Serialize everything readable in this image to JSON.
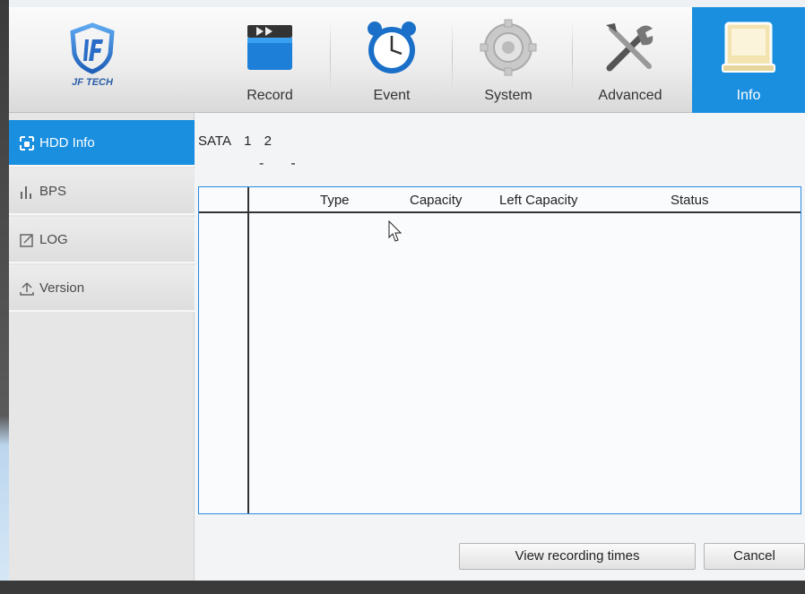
{
  "logo": {
    "text": "JF TECH"
  },
  "nav": [
    {
      "label": "Record",
      "icon": "record-clapper-icon"
    },
    {
      "label": "Event",
      "icon": "alarm-clock-icon"
    },
    {
      "label": "System",
      "icon": "gear-icon"
    },
    {
      "label": "Advanced",
      "icon": "tools-icon"
    },
    {
      "label": "Info",
      "icon": "info-document-icon",
      "active": true
    }
  ],
  "sidebar": {
    "items": [
      {
        "label": "HDD Info",
        "icon": "hdd-icon",
        "active": true
      },
      {
        "label": "BPS",
        "icon": "bar-chart-icon"
      },
      {
        "label": "LOG",
        "icon": "log-edit-icon"
      },
      {
        "label": "Version",
        "icon": "version-upload-icon"
      }
    ]
  },
  "content": {
    "sata_label": "SATA",
    "sata_ports": [
      "1",
      "2"
    ],
    "sata_status": [
      "-",
      "-"
    ],
    "table": {
      "columns": [
        "",
        "Type",
        "Capacity",
        "Left Capacity",
        "Status"
      ],
      "rows": []
    },
    "buttons": {
      "view_recording_times": "View recording times",
      "cancel": "Cancel"
    }
  },
  "colors": {
    "accent": "#1a8fe0",
    "table_border": "#2a8be2"
  }
}
